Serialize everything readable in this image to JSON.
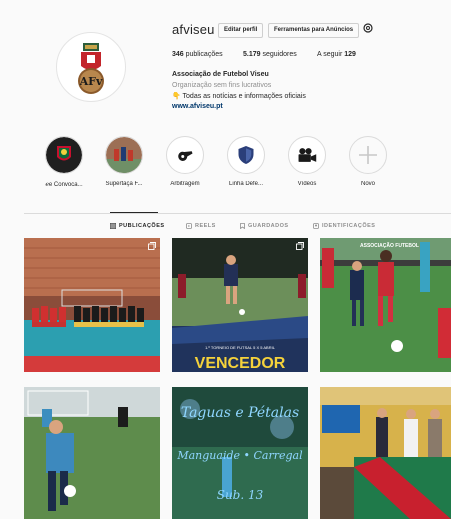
{
  "profile": {
    "username": "afviseu",
    "edit_profile_label": "Editar perfil",
    "ad_tools_label": "Ferramentas para Anúncios",
    "stats": {
      "posts": "346",
      "posts_label": " publicações",
      "followers": "5.179",
      "followers_label": " seguidores",
      "following_label": "A seguir ",
      "following": "129"
    },
    "bio": {
      "name": "Associação de Futebol Viseu",
      "category": "Organização sem fins lucrativos",
      "line": "👇 Todas as notícias e informações oficiais",
      "link": "www.afviseu.pt"
    }
  },
  "highlights": [
    {
      "label": "ℯe Convoca...",
      "icon": "portugal-federation-icon"
    },
    {
      "label": "Supertaça F...",
      "icon": "team-photo-icon"
    },
    {
      "label": "Arbitragem",
      "icon": "whistle-icon"
    },
    {
      "label": "Linha Defe...",
      "icon": "shield-icon"
    },
    {
      "label": "Vídeos",
      "icon": "video-camera-icon"
    },
    {
      "label": "Novo",
      "icon": "plus-icon"
    }
  ],
  "tabs": [
    {
      "label": "PUBLICAÇÕES",
      "active": true
    },
    {
      "label": "REELS",
      "active": false
    },
    {
      "label": "GUARDADOS",
      "active": false
    },
    {
      "label": "IDENTIFICAÇÕES",
      "active": false
    }
  ],
  "posts": {
    "post2_banner": "VENCEDOR",
    "post2_subtitle": "1.º TORNEIO DE FUTSAL 5 X 5 ABRIL",
    "post5_line1": "Taguas e Pétalas",
    "post5_line2": "Manguaide • Carregal",
    "post5_line3": "Sub. 13",
    "post3_header": "ASSOCIAÇÃO FUTEBOL"
  },
  "colors": {
    "accent_link": "#00376b",
    "muted": "#8e8e8e",
    "border": "#dbdbdb"
  }
}
